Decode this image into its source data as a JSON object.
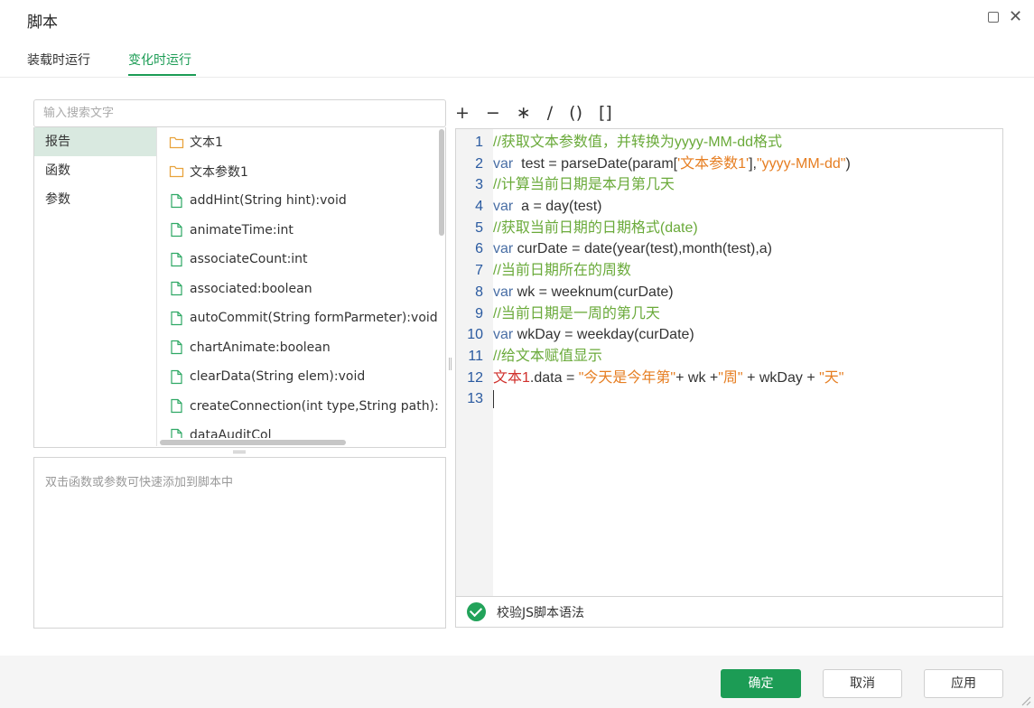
{
  "window": {
    "title": "脚本"
  },
  "tabs": [
    {
      "label": "装载时运行",
      "active": false
    },
    {
      "label": "变化时运行",
      "active": true
    }
  ],
  "search": {
    "placeholder": "输入搜索文字"
  },
  "categories": [
    "报告",
    "函数",
    "参数"
  ],
  "items": [
    {
      "label": "文本1",
      "icon": "folder-icon"
    },
    {
      "label": "文本参数1",
      "icon": "folder-icon"
    },
    {
      "label": "addHint(String hint):void",
      "icon": "file-icon"
    },
    {
      "label": "animateTime:int",
      "icon": "file-icon"
    },
    {
      "label": "associateCount:int",
      "icon": "file-icon"
    },
    {
      "label": "associated:boolean",
      "icon": "file-icon"
    },
    {
      "label": "autoCommit(String formParmeter):void",
      "icon": "file-icon"
    },
    {
      "label": "chartAnimate:boolean",
      "icon": "file-icon"
    },
    {
      "label": "clearData(String elem):void",
      "icon": "file-icon"
    },
    {
      "label": "createConnection(int type,String path):Ob",
      "icon": "file-icon"
    },
    {
      "label": "dataAuditCol",
      "icon": "file-icon"
    }
  ],
  "description": "双击函数或参数可快速添加到脚本中",
  "operators": [
    "+",
    "−",
    "∗",
    "/",
    "()",
    "[]"
  ],
  "editor": {
    "line_numbers": [
      "1",
      "2",
      "3",
      "4",
      "5",
      "6",
      "7",
      "8",
      "9",
      "10",
      "11",
      "12",
      "13"
    ],
    "l1": "//获取文本参数值，并转换为yyyy-MM-dd格式",
    "l2a": "var",
    "l2b": "  test = parseDate(param[",
    "l2c": "'文本参数1'",
    "l2d": "],",
    "l2e": "\"yyyy-MM-dd\"",
    "l2f": ")",
    "l3": "//计算当前日期是本月第几天",
    "l4a": "var",
    "l4b": "  a = day(test)",
    "l5": "//获取当前日期的日期格式(date)",
    "l6a": "var",
    "l6b": " curDate = date(year(test),month(test),a)",
    "l7": "//当前日期所在的周数",
    "l8a": "var",
    "l8b": " wk = weeknum(curDate)",
    "l9": "//当前日期是一周的第几天",
    "l10a": "var",
    "l10b": " wkDay = weekday(curDate)",
    "l11": "//给文本赋值显示",
    "l12a": "文本1",
    "l12b": ".data = ",
    "l12c": "\"今天是今年第\"",
    "l12d": "+ wk +",
    "l12e": "\"周\"",
    "l12f": " + wkDay + ",
    "l12g": "\"天\""
  },
  "validate": {
    "label": "校验JS脚本语法"
  },
  "buttons": {
    "ok": "确定",
    "cancel": "取消",
    "apply": "应用"
  },
  "colors": {
    "accent": "#1c9c55",
    "comment": "#6aaa3a",
    "string": "#e67e22",
    "keyword": "#4a6fa5",
    "variable": "#d0312d"
  }
}
